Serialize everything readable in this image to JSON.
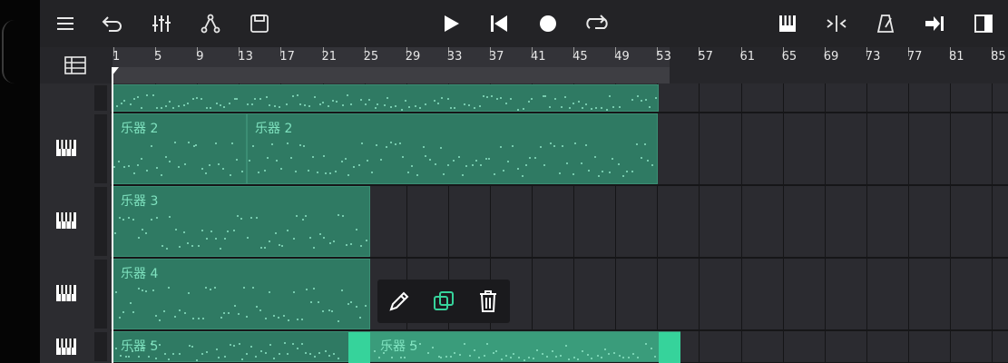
{
  "toolbar": {
    "left_icons": [
      "menu-icon",
      "undo-icon",
      "mixer-icon",
      "automation-icon",
      "save-icon"
    ],
    "center_icons": [
      "play-icon",
      "skip-to-start-icon",
      "record-icon",
      "loop-icon"
    ],
    "right_icons": [
      "keyboard-icon",
      "snap-icon",
      "metronome-icon",
      "follow-playhead-icon",
      "panel-toggle-icon"
    ]
  },
  "ruler": {
    "bars": [
      "1",
      "5",
      "9",
      "13",
      "17",
      "21",
      "25",
      "29",
      "33",
      "37",
      "41",
      "45",
      "49",
      "53",
      "57",
      "61",
      "65",
      "69",
      "73",
      "77",
      "81",
      "85"
    ]
  },
  "tracks": [
    {
      "clips": [
        {
          "label": ""
        }
      ]
    },
    {
      "clips": [
        {
          "label": "乐器 2"
        },
        {
          "label": "乐器 2"
        }
      ]
    },
    {
      "clips": [
        {
          "label": "乐器 3"
        }
      ]
    },
    {
      "clips": [
        {
          "label": "乐器 4"
        }
      ]
    },
    {
      "clips": [
        {
          "label": "乐器 5"
        },
        {
          "label": "乐器 5"
        }
      ]
    }
  ],
  "popup": {
    "actions": [
      "pencil-icon",
      "duplicate-icon",
      "trash-icon"
    ]
  },
  "colors": {
    "clip": "#2f7a63",
    "clip_selected": "#3a9c7b",
    "clip_label": "#7fe2bf",
    "accent": "#36d39b"
  }
}
